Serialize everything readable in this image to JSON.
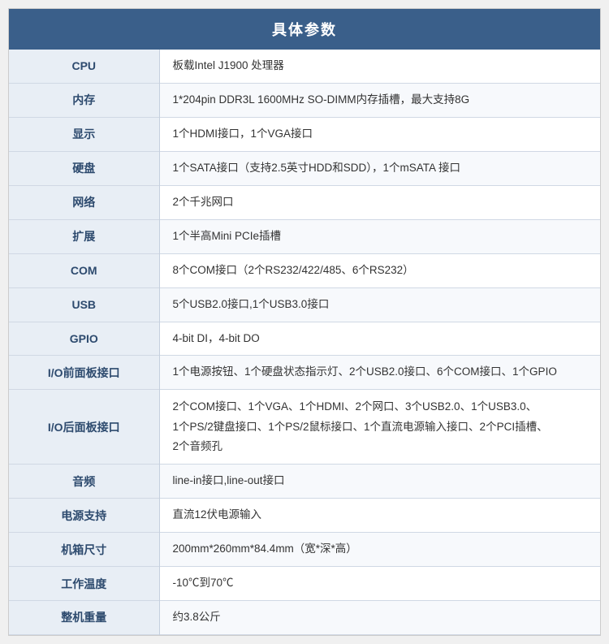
{
  "title": "具体参数",
  "rows": [
    {
      "label": "CPU",
      "value": "板载Intel J1900 处理器"
    },
    {
      "label": "内存",
      "value": "1*204pin DDR3L 1600MHz SO-DIMM内存插槽，最大支持8G"
    },
    {
      "label": "显示",
      "value": "1个HDMI接口，1个VGA接口"
    },
    {
      "label": "硬盘",
      "value": "1个SATA接口（支持2.5英寸HDD和SDD），1个mSATA 接口"
    },
    {
      "label": "网络",
      "value": "2个千兆网口"
    },
    {
      "label": "扩展",
      "value": "1个半高Mini PCIe插槽"
    },
    {
      "label": "COM",
      "value": "8个COM接口（2个RS232/422/485、6个RS232）"
    },
    {
      "label": "USB",
      "value": "5个USB2.0接口,1个USB3.0接口"
    },
    {
      "label": "GPIO",
      "value": "4-bit DI，4-bit DO"
    },
    {
      "label": "I/O前面板接口",
      "value": "1个电源按钮、1个硬盘状态指示灯、2个USB2.0接口、6个COM接口、1个GPIO"
    },
    {
      "label": "I/O后面板接口",
      "value": "2个COM接口、1个VGA、1个HDMI、2个网口、3个USB2.0、1个USB3.0、\n1个PS/2键盘接口、1个PS/2鼠标接口、1个直流电源输入接口、2个PCI插槽、\n2个音频孔"
    },
    {
      "label": "音频",
      "value": "line-in接口,line-out接口"
    },
    {
      "label": "电源支持",
      "value": "直流12伏电源输入"
    },
    {
      "label": "机箱尺寸",
      "value": "200mm*260mm*84.4mm（宽*深*高）"
    },
    {
      "label": "工作温度",
      "value": "-10℃到70℃"
    },
    {
      "label": "整机重量",
      "value": "约3.8公斤"
    }
  ]
}
